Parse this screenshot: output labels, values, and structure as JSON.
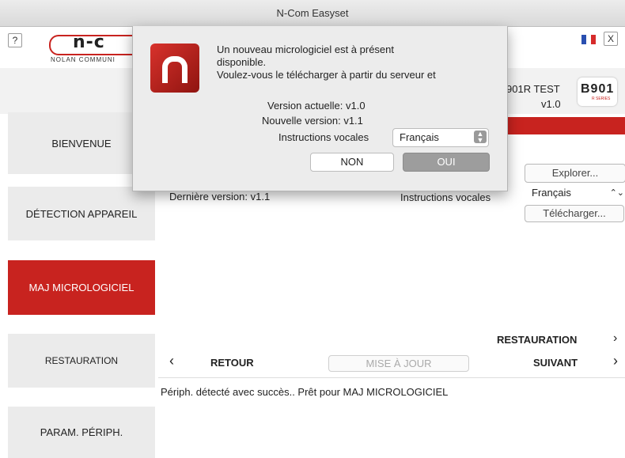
{
  "window": {
    "title": "N-Com Easyset"
  },
  "header": {
    "help_label": "?",
    "close_label": "X",
    "logo_text": "n-c",
    "logo_subtext": "NOLAN COMMUNI",
    "device_name": "901R TEST",
    "device_version": "v1.0",
    "device_logo_text": "B901",
    "device_logo_sub": "R SERIES"
  },
  "sidebar": {
    "items": [
      {
        "label": "BIENVENUE"
      },
      {
        "label": "DÉTECTION APPAREIL"
      },
      {
        "label": "MAJ MICROLOGICIEL",
        "active": true
      },
      {
        "label": "RESTAURATION"
      },
      {
        "label": "PARAM. PÉRIPH."
      }
    ]
  },
  "main": {
    "explorer_label": "Explorer...",
    "latest_version": "Dernière version: v1.1",
    "voice_label": "Instructions vocales",
    "voice_value": "Français",
    "download_label": "Télécharger...",
    "restore_label": "RESTAURATION",
    "back_label": "RETOUR",
    "update_label": "MISE À JOUR",
    "next_label": "SUIVANT",
    "status_text": "Périph. détecté avec succès.. Prêt pour MAJ MICROLOGICIEL"
  },
  "dialog": {
    "line1": "Un nouveau micrologiciel est à présent",
    "line2": "disponible.",
    "line3": "Voulez-vous le télécharger à partir du serveur et",
    "current_version": "Version actuelle: v1.0",
    "new_version": "Nouvelle version: v1.1",
    "voice_label": "Instructions vocales",
    "voice_value": "Français",
    "no_label": "NON",
    "yes_label": "OUI"
  },
  "colors": {
    "accent": "#c8231f",
    "sidebar_bg": "#ebebeb"
  }
}
